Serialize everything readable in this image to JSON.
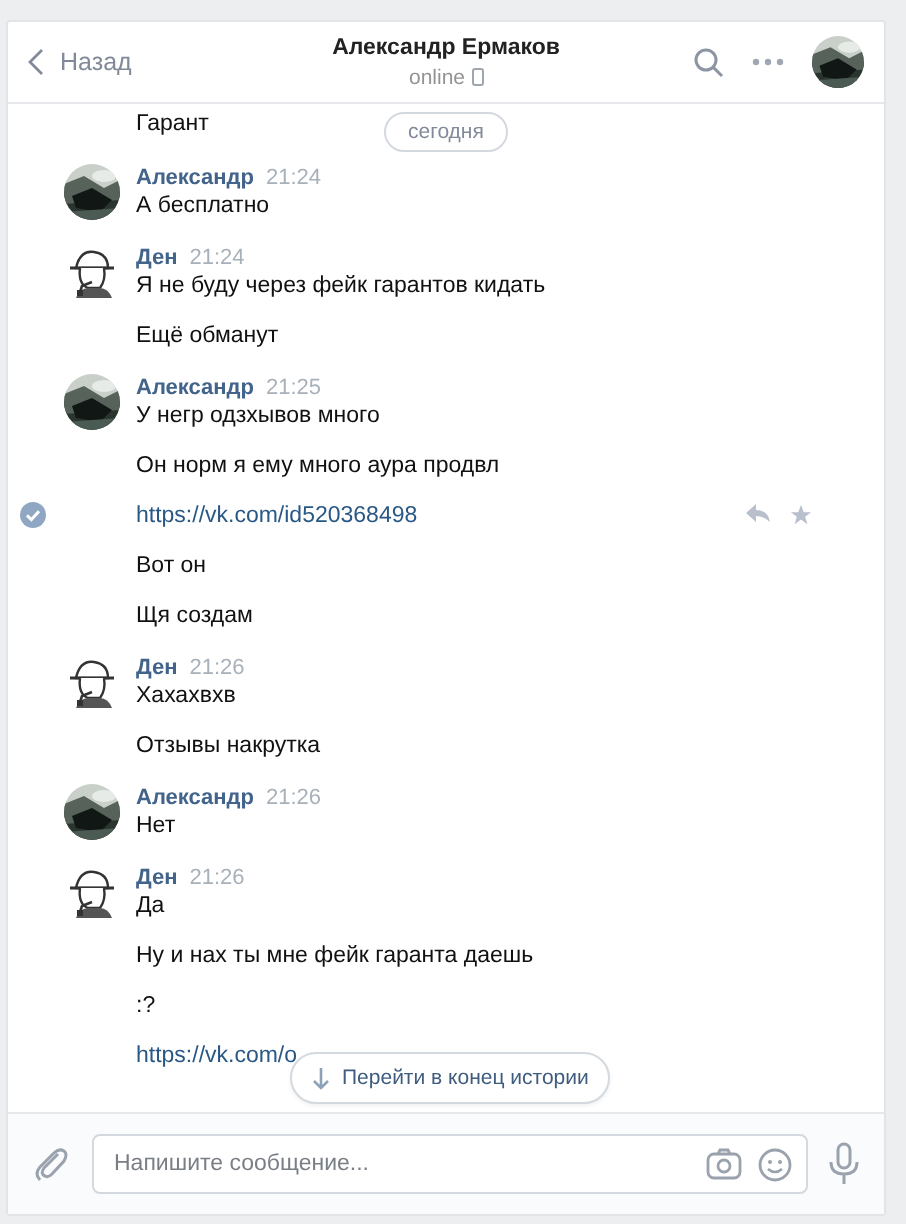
{
  "header": {
    "back": "Назад",
    "title": "Александр Ермаков",
    "status": "online"
  },
  "date_pill": "сегодня",
  "tail": {
    "text": "Гарант"
  },
  "groups": [
    {
      "name": "Александр",
      "time": "21:24",
      "messages": [
        {
          "kind": "text",
          "text": "А бесплатно",
          "selected": false
        }
      ]
    },
    {
      "kind": "detective",
      "name": "Ден",
      "time": "21:24",
      "messages": [
        {
          "kind": "text",
          "text": "Я не буду через фейк гарантов кидать",
          "selected": false
        },
        {
          "kind": "text",
          "text": "Ещё обманут",
          "selected": false
        }
      ]
    },
    {
      "name": "Александр",
      "time": "21:25",
      "messages": [
        {
          "kind": "text",
          "text": "У негр одзхывов много",
          "selected": false
        },
        {
          "kind": "text",
          "text": "Он норм я ему много аура продвл",
          "selected": false
        },
        {
          "kind": "link",
          "text": "https://vk.com/id520368498",
          "selected": true
        },
        {
          "kind": "text",
          "text": "Вот он",
          "selected": false
        },
        {
          "kind": "text",
          "text": "Щя создам",
          "selected": false
        }
      ]
    },
    {
      "kind": "detective",
      "name": "Ден",
      "time": "21:26",
      "messages": [
        {
          "kind": "text",
          "text": "Хахахвхв",
          "selected": false
        },
        {
          "kind": "text",
          "text": "Отзывы накрутка",
          "selected": false
        }
      ]
    },
    {
      "name": "Александр",
      "time": "21:26",
      "messages": [
        {
          "kind": "text",
          "text": "Нет",
          "selected": false
        }
      ]
    },
    {
      "kind": "detective",
      "name": "Ден",
      "time": "21:26",
      "messages": [
        {
          "kind": "text",
          "text": "Да",
          "selected": false
        },
        {
          "kind": "text",
          "text": "Ну и нах ты мне фейк гаранта даешь",
          "selected": false
        },
        {
          "kind": "text",
          "text": ":?",
          "selected": false
        },
        {
          "kind": "link",
          "text": "https://vk.com/o",
          "selected": false
        }
      ]
    }
  ],
  "jump_button": "Перейти в конец истории",
  "composer": {
    "placeholder": "Напишите сообщение..."
  }
}
